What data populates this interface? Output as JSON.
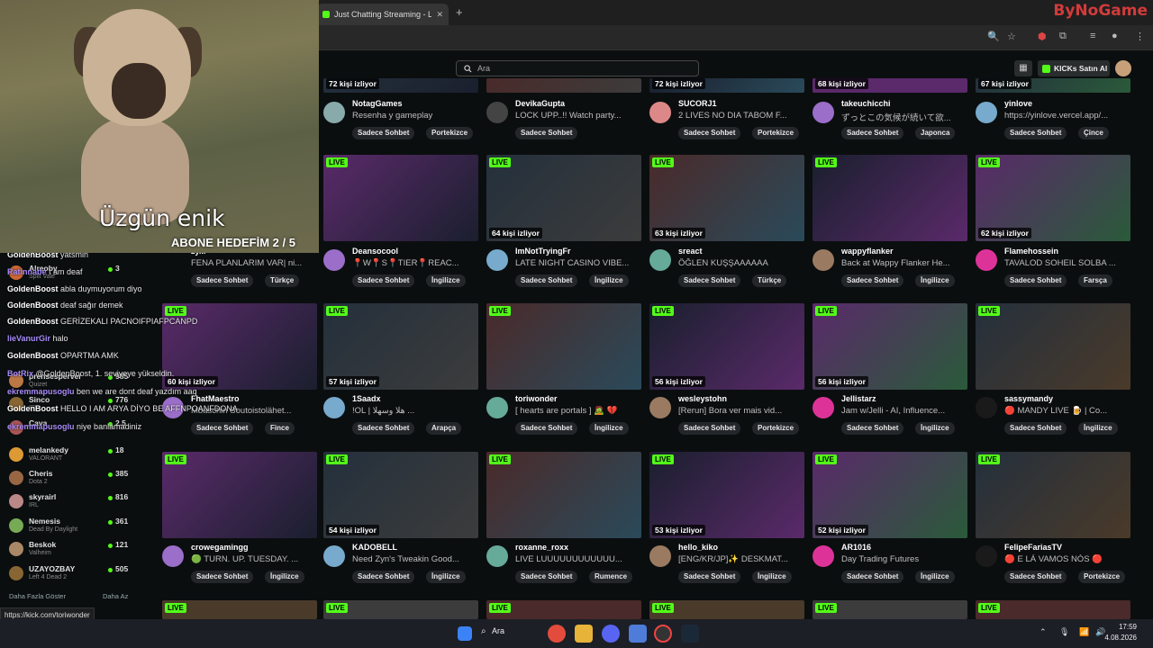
{
  "browser": {
    "tab_title": "Just Chatting Streaming - Live",
    "new_tab": "+",
    "brand": "ByNoGame"
  },
  "header": {
    "search_placeholder": "Ara",
    "buy_kicks": "KICKs Satın Al"
  },
  "video": {
    "caption": "Üzgün enik",
    "goal": "ABONE HEDEFİM 2 / 5"
  },
  "top_row": [
    {
      "viewers": "72 kişi izliyor",
      "name": "NotagGames",
      "title": "Resenha y gameplay",
      "tags": [
        "Sadece Sohbet",
        "Portekizce"
      ]
    },
    {
      "viewers": "",
      "name": "DevikaGupta",
      "title": "LOCK UPP..!! Watch party...",
      "tags": [
        "Sadece Sohbet"
      ]
    },
    {
      "viewers": "72 kişi izliyor",
      "name": "SUCORJ1",
      "title": "2 LIVES NO DIA TABOM F...",
      "tags": [
        "Sadece Sohbet",
        "Portekizce"
      ]
    },
    {
      "viewers": "68 kişi izliyor",
      "name": "takeuchicchi",
      "title": "ずっとこの気候が続いて欲...",
      "tags": [
        "Sadece Sohbet",
        "Japonca"
      ]
    },
    {
      "viewers": "67 kişi izliyor",
      "name": "yinlove",
      "title": "https://yinlove.vercel.app/...",
      "tags": [
        "Sadece Sohbet",
        "Çince"
      ]
    }
  ],
  "row2": [
    {
      "viewers": "",
      "name": "Deansocool",
      "title": "📍W📍S📍TIER📍REAC...",
      "tags": [
        "Sadece Sohbet",
        "İngilizce"
      ]
    },
    {
      "viewers": "64 kişi izliyor",
      "name": "ImNotTryingFr",
      "title": "LATE NIGHT CASINO VIBE...",
      "tags": [
        "Sadece Sohbet",
        "İngilizce"
      ]
    },
    {
      "viewers": "63 kişi izliyor",
      "name": "sreact",
      "title": "ÖĞLEN KUŞŞAAAAAA",
      "tags": [
        "Sadece Sohbet",
        "Türkçe"
      ]
    },
    {
      "viewers": "",
      "name": "wappyflanker",
      "title": "Back at Wappy Flanker He...",
      "tags": [
        "Sadece Sohbet",
        "İngilizce"
      ]
    },
    {
      "viewers": "62 kişi izliyor",
      "name": "Flamehossein",
      "title": "TAVALOD SOHEIL SOLBA ...",
      "tags": [
        "Sadece Sohbet",
        "Farsça"
      ]
    }
  ],
  "row2_partial": {
    "name": "zy...",
    "title": "FENA PLANLARIM VAR| ni...",
    "tags": [
      "Sadece Sohbet",
      "Türkçe"
    ]
  },
  "row3": [
    {
      "viewers": "60 kişi izliyor",
      "name": "FhatMaestro",
      "title": "Mbaschin Soutoistolähet...",
      "tags": [
        "Sadece Sohbet",
        "Fince"
      ]
    },
    {
      "viewers": "57 kişi izliyor",
      "name": "1Saadx",
      "title": "!OL | هلا وسهلا ...",
      "tags": [
        "Sadece Sohbet",
        "Arapça"
      ]
    },
    {
      "viewers": "",
      "name": "toriwonder",
      "title": "[ hearts are portals ] 🧟 💔",
      "tags": [
        "Sadece Sohbet",
        "İngilizce"
      ]
    },
    {
      "viewers": "56 kişi izliyor",
      "name": "wesleystohn",
      "title": "[Rerun] Bora ver mais vid...",
      "tags": [
        "Sadece Sohbet",
        "Portekizce"
      ]
    },
    {
      "viewers": "56 kişi izliyor",
      "name": "Jellistarz",
      "title": "Jam w/Jelli - AI, Influence...",
      "tags": [
        "Sadece Sohbet",
        "İngilizce"
      ]
    },
    {
      "viewers": "",
      "name": "sassymandy",
      "title": "🔴 MANDY LIVE 🍺 | Co...",
      "tags": [
        "Sadece Sohbet",
        "İngilizce"
      ]
    }
  ],
  "row4": [
    {
      "viewers": "",
      "name": "crowegamingg",
      "title": "🟢 TURN. UP. TUESDAY. ...",
      "tags": [
        "Sadece Sohbet",
        "İngilizce"
      ]
    },
    {
      "viewers": "54 kişi izliyor",
      "name": "KADOBELL",
      "title": "Need Zyn's Tweakin Good...",
      "tags": [
        "Sadece Sohbet",
        "İngilizce"
      ]
    },
    {
      "viewers": "",
      "name": "roxanne_roxx",
      "title": "LIVE LUUUUUUUUUUUU...",
      "tags": [
        "Sadece Sohbet",
        "Rumence"
      ]
    },
    {
      "viewers": "53 kişi izliyor",
      "name": "hello_kiko",
      "title": "[ENG/KR/JP]✨ DESKMAT...",
      "tags": [
        "Sadece Sohbet",
        "İngilizce"
      ]
    },
    {
      "viewers": "52 kişi izliyor",
      "name": "AR1016",
      "title": "Day Trading Futures",
      "tags": [
        "Sadece Sohbet",
        "İngilizce"
      ]
    },
    {
      "viewers": "",
      "name": "FelipeFariasTV",
      "title": "🔴 E LÁ VAMOS NÓS 🔴",
      "tags": [
        "Sadece Sohbet",
        "Portekizce"
      ]
    }
  ],
  "live_label": "LIVE",
  "sidebar": {
    "items": [
      {
        "name": "Alreoby",
        "cat": "Split Vale",
        "count": "3"
      },
      {
        "name": "prensesperver",
        "cat": "Quizet",
        "count": "985"
      },
      {
        "name": "Sinco",
        "cat": "IRL",
        "count": "776"
      },
      {
        "name": "Cava",
        "cat": "",
        "count": "2.5"
      },
      {
        "name": "melankedy",
        "cat": "VALORANT",
        "count": "18"
      },
      {
        "name": "Cheris",
        "cat": "Dota 2",
        "count": "385"
      },
      {
        "name": "skyrairl",
        "cat": "IRL",
        "count": "816"
      },
      {
        "name": "Nemesis",
        "cat": "Dead By Daylight",
        "count": "361"
      },
      {
        "name": "Beskok",
        "cat": "Valheim",
        "count": "121"
      },
      {
        "name": "UZAYOZBAY",
        "cat": "Left 4 Dead 2",
        "count": "505"
      }
    ],
    "show_more": "Daha Fazla Göster",
    "show_less": "Daha Az"
  },
  "chat": [
    {
      "user": "GoldenBoost",
      "msg": "yatsmin"
    },
    {
      "user": "Ratinnabe",
      "msg": "I am deaf"
    },
    {
      "user": "GoldenBoost",
      "msg": "abla duymuyorum diyo"
    },
    {
      "user": "GoldenBoost",
      "msg": "deaf sağır demek"
    },
    {
      "user": "GoldenBoost",
      "msg": "GERİZEKALI PACNOIFPIAFPCANPD"
    },
    {
      "user": "lieVanurGir",
      "msg": "halo"
    },
    {
      "user": "GoldenBoost",
      "msg": "OPARTMA AMK"
    },
    {
      "user": "BotRix",
      "msg": "@GoldenBoost, 1. seviyeye yükseldin."
    },
    {
      "user": "ekremmapusoglu",
      "msg": "ben we are dont deaf yazdım aaq"
    },
    {
      "user": "GoldenBoost",
      "msg": "HELLO I AM ARYA DİYO BE AFFNPOANFDONA"
    },
    {
      "user": "ekremmapusoglu",
      "msg": "niye banlamadiniz"
    }
  ],
  "status_url": "https://kick.com/toriwonder",
  "taskbar": {
    "search": "Ara",
    "time": "17:59",
    "date": "4.08.2026"
  }
}
